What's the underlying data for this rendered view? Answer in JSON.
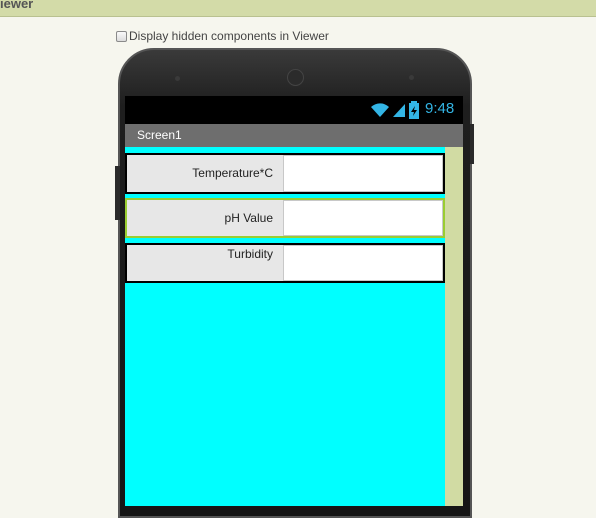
{
  "panel": {
    "title": "iewer"
  },
  "viewer": {
    "hidden_components_label": "Display hidden components in Viewer"
  },
  "status_bar": {
    "time": "9:48",
    "icons": [
      "wifi-icon",
      "signal-icon",
      "battery-icon"
    ]
  },
  "screen": {
    "title": "Screen1"
  },
  "rows": [
    {
      "label": "Temperature*C",
      "value": ""
    },
    {
      "label": "pH Value",
      "value": ""
    },
    {
      "label": "Turbidity",
      "value": ""
    }
  ],
  "colors": {
    "canvas": "#00ffff",
    "header": "#d3dba8",
    "clock": "#33b5e5",
    "selection": "#9acd32"
  }
}
